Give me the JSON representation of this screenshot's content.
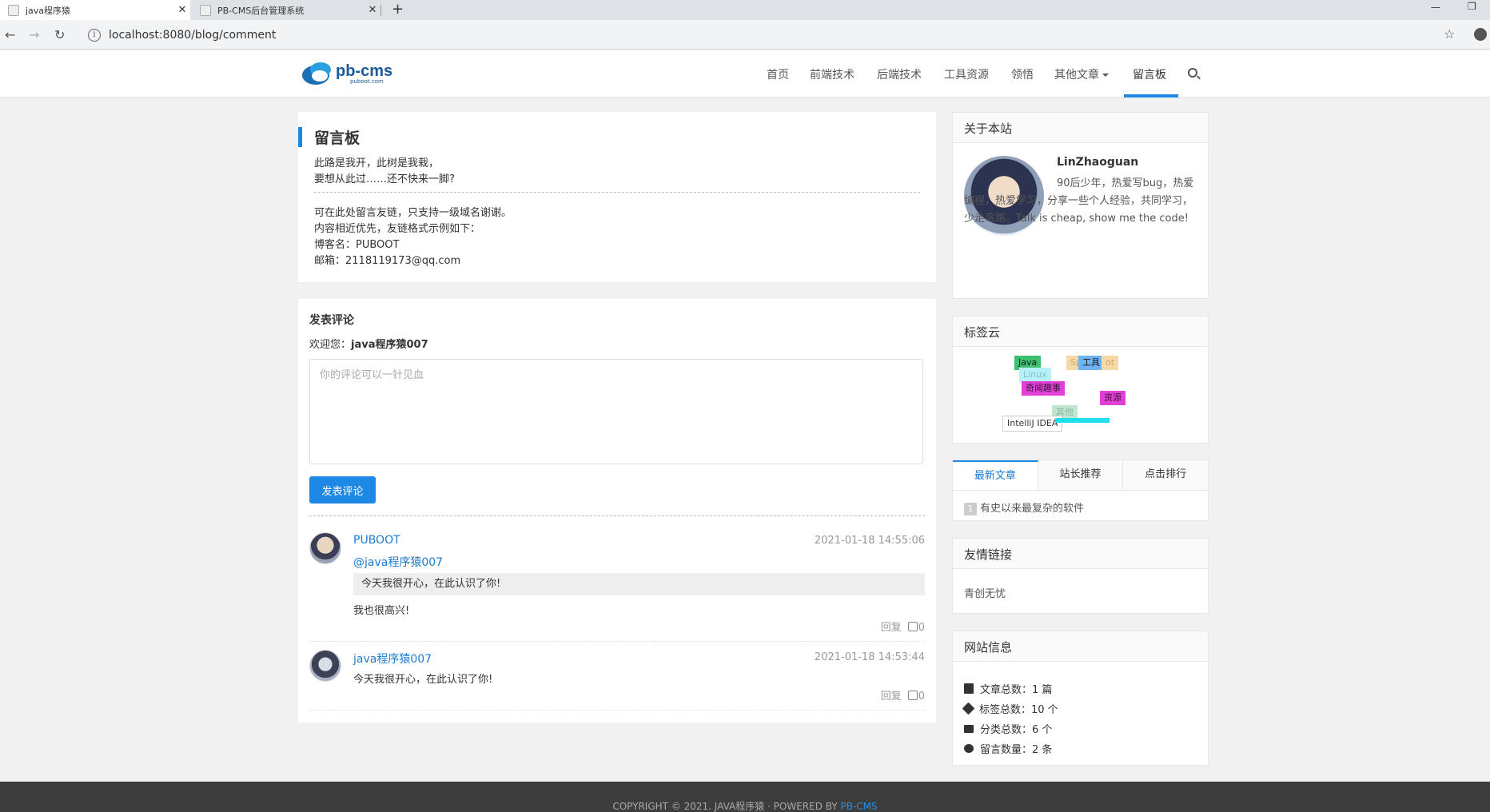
{
  "browser": {
    "tabs": [
      {
        "title": "java程序猿",
        "close": "✕"
      },
      {
        "title": "PB-CMS后台管理系统",
        "close": "✕"
      }
    ],
    "new_tab": "+",
    "url": "localhost:8080/blog/comment"
  },
  "header": {
    "logo_main": "pb-cms",
    "logo_sub": "puboot.com",
    "nav": [
      "首页",
      "前端技术",
      "后端技术",
      "工具资源",
      "领悟",
      "其他文章",
      "留言板"
    ],
    "active_nav": "留言板"
  },
  "board": {
    "title": "留言板",
    "lines_top": [
      "此路是我开，此树是我栽，",
      "要想从此过……还不快来一脚?"
    ],
    "lines_bottom": [
      "可在此处留言友链，只支持一级域名谢谢。",
      "内容相近优先，友链格式示例如下：",
      "博客名：PUBOOT",
      "邮箱：2118119173@qq.com"
    ]
  },
  "comment_form": {
    "title": "发表评论",
    "welcome_prefix": "欢迎您：",
    "username": "java程序猿007",
    "placeholder": "你的评论可以一针见血",
    "submit": "发表评论"
  },
  "comments": [
    {
      "author": "PUBOOT",
      "time": "2021-01-18 14:55:06",
      "reply_to": "@java程序猿007",
      "quote": "今天我很开心，在此认识了你!",
      "text": "我也很高兴!",
      "reply_label": "回复",
      "likes": "0"
    },
    {
      "author": "java程序猿007",
      "time": "2021-01-18 14:53:44",
      "text": "今天我很开心，在此认识了你!",
      "reply_label": "回复",
      "likes": "0"
    }
  ],
  "sidebar": {
    "about": {
      "title": "关于本站",
      "name": "LinZhaoguan",
      "bio": "90后少年，热爱写bug，热爱编程，热爱学习，分享一些个人经验，共同学习，少走弯路。Talk is cheap, show me the code!"
    },
    "tag_cloud": {
      "title": "标签云",
      "tags": [
        {
          "label": "Java",
          "color": "#3fbf6f",
          "text": "#1a1a1a"
        },
        {
          "label": "Sp",
          "color": "#f7d9a8",
          "text": "#c9a86b"
        },
        {
          "label": "工具",
          "color": "#6fb3f2",
          "text": "#1a1a1a"
        },
        {
          "label": "ot",
          "color": "#f7d9a8",
          "text": "#c9a86b"
        },
        {
          "label": "Linux",
          "color": "#b8f0f7",
          "text": "#7fbfd0"
        },
        {
          "label": "奇闻趣事",
          "color": "#e23fd6",
          "text": "#3a1a3a"
        },
        {
          "label": "资源",
          "color": "#e23fd6",
          "text": "#3a1a3a"
        },
        {
          "label": "其他",
          "color": "#bfe6cf",
          "text": "#8fb89f"
        },
        {
          "label": "IntelliJ IDEA",
          "color": "#ffffff",
          "text": "#333333"
        }
      ]
    },
    "tabs": [
      "最新文章",
      "站长推荐",
      "点击排行"
    ],
    "latest": [
      {
        "num": "1",
        "title": "有史以来最复杂的软件"
      }
    ],
    "links": {
      "title": "友情链接",
      "items": [
        "青创无忧"
      ]
    },
    "site_info": {
      "title": "网站信息",
      "rows": [
        {
          "icon": "file-icon",
          "label": "文章总数：1 篇"
        },
        {
          "icon": "tags-icon",
          "label": "标签总数：10 个"
        },
        {
          "icon": "folder-open-icon",
          "label": "分类总数：6 个"
        },
        {
          "icon": "comments-icon",
          "label": "留言数量：2 条"
        }
      ]
    }
  },
  "footer": {
    "text": "COPYRIGHT © 2021. JAVA程序猿 · POWERED BY ",
    "link": "PB-CMS"
  }
}
